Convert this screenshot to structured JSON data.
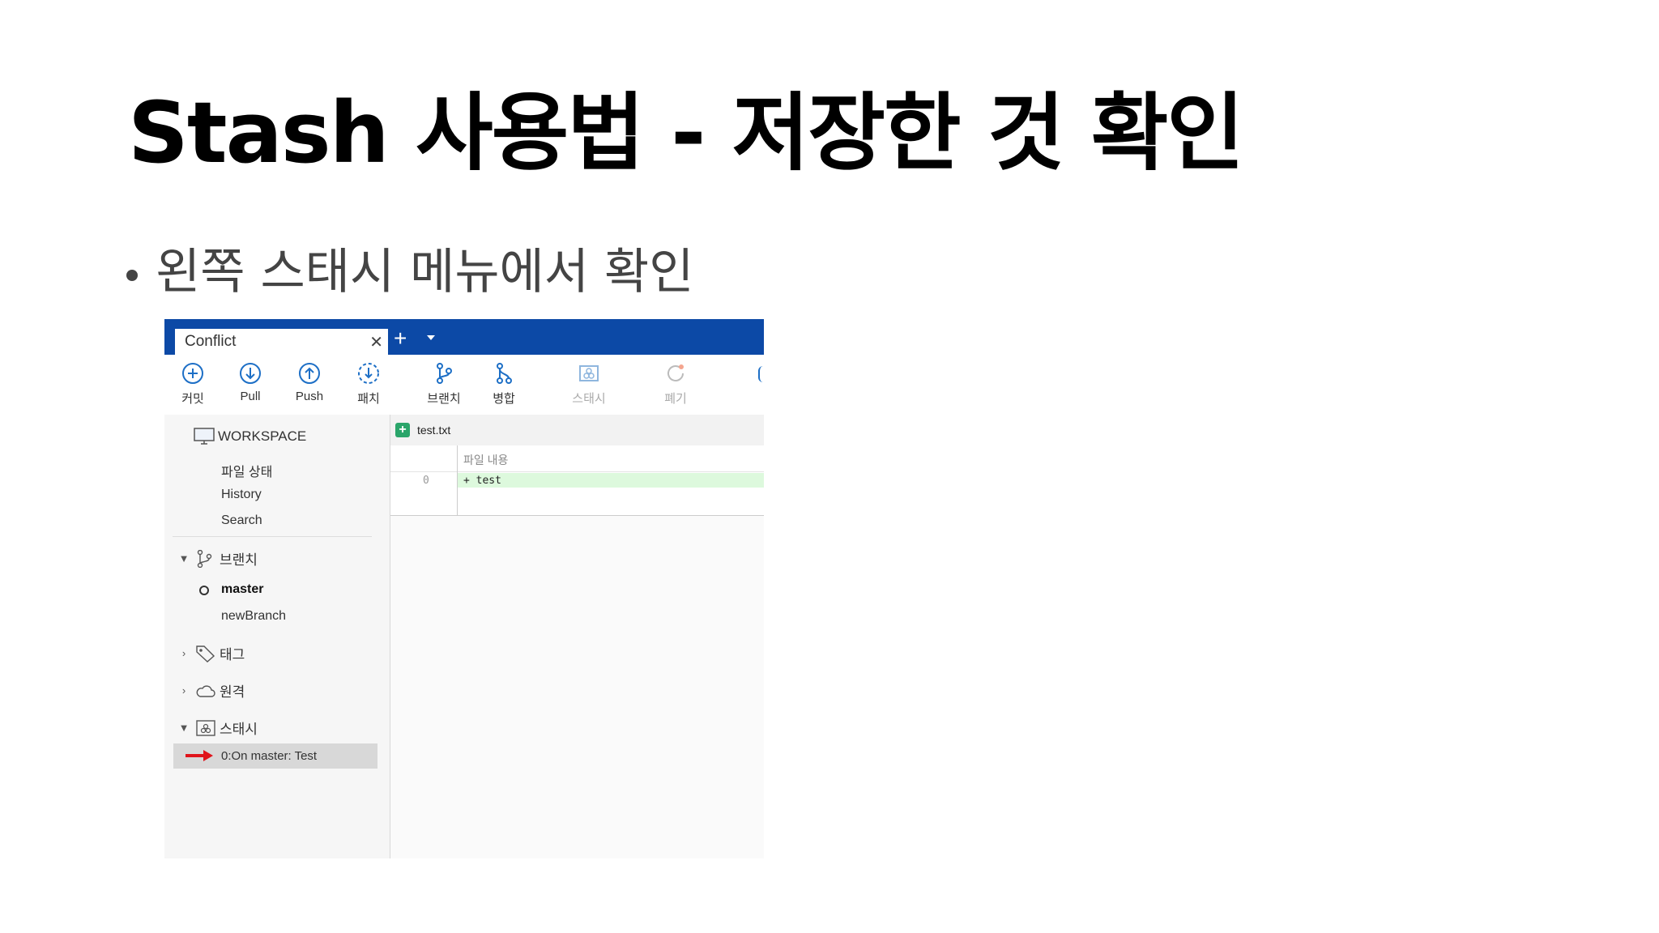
{
  "slide": {
    "title": "Stash 사용법 - 저장한 것 확인",
    "bullet": "왼쪽 스태시 메뉴에서 확인"
  },
  "app": {
    "tab": {
      "label": "Conflict",
      "close": "✕",
      "add": "+"
    },
    "toolbar": [
      {
        "label": "커밋",
        "icon": "commit-icon",
        "enabled": true
      },
      {
        "label": "Pull",
        "icon": "pull-icon",
        "enabled": true
      },
      {
        "label": "Push",
        "icon": "push-icon",
        "enabled": true
      },
      {
        "label": "패치",
        "icon": "patch-icon",
        "enabled": true
      },
      {
        "label": "브랜치",
        "icon": "branch-icon",
        "enabled": true
      },
      {
        "label": "병합",
        "icon": "merge-icon",
        "enabled": true
      },
      {
        "label": "스태시",
        "icon": "stash-icon",
        "enabled": false
      },
      {
        "label": "폐기",
        "icon": "discard-icon",
        "enabled": false
      }
    ],
    "sidebar": {
      "workspace": {
        "label": "WORKSPACE",
        "items": [
          "파일 상태",
          "History",
          "Search"
        ]
      },
      "branches": {
        "label": "브랜치",
        "items": [
          "master",
          "newBranch"
        ],
        "current": "master"
      },
      "tags": {
        "label": "태그"
      },
      "remotes": {
        "label": "원격"
      },
      "stashes": {
        "label": "스태시",
        "items": [
          "0:On master: Test"
        ]
      }
    },
    "content": {
      "file_name": "test.txt",
      "diff_header": "파일 내용",
      "line_number": "0",
      "line_code": "+ test"
    }
  },
  "colors": {
    "tabbar": "#0c49a6",
    "accent_icon": "#1d6fc6",
    "added_line": "#ddf9dd",
    "arrow": "#e0141b"
  }
}
